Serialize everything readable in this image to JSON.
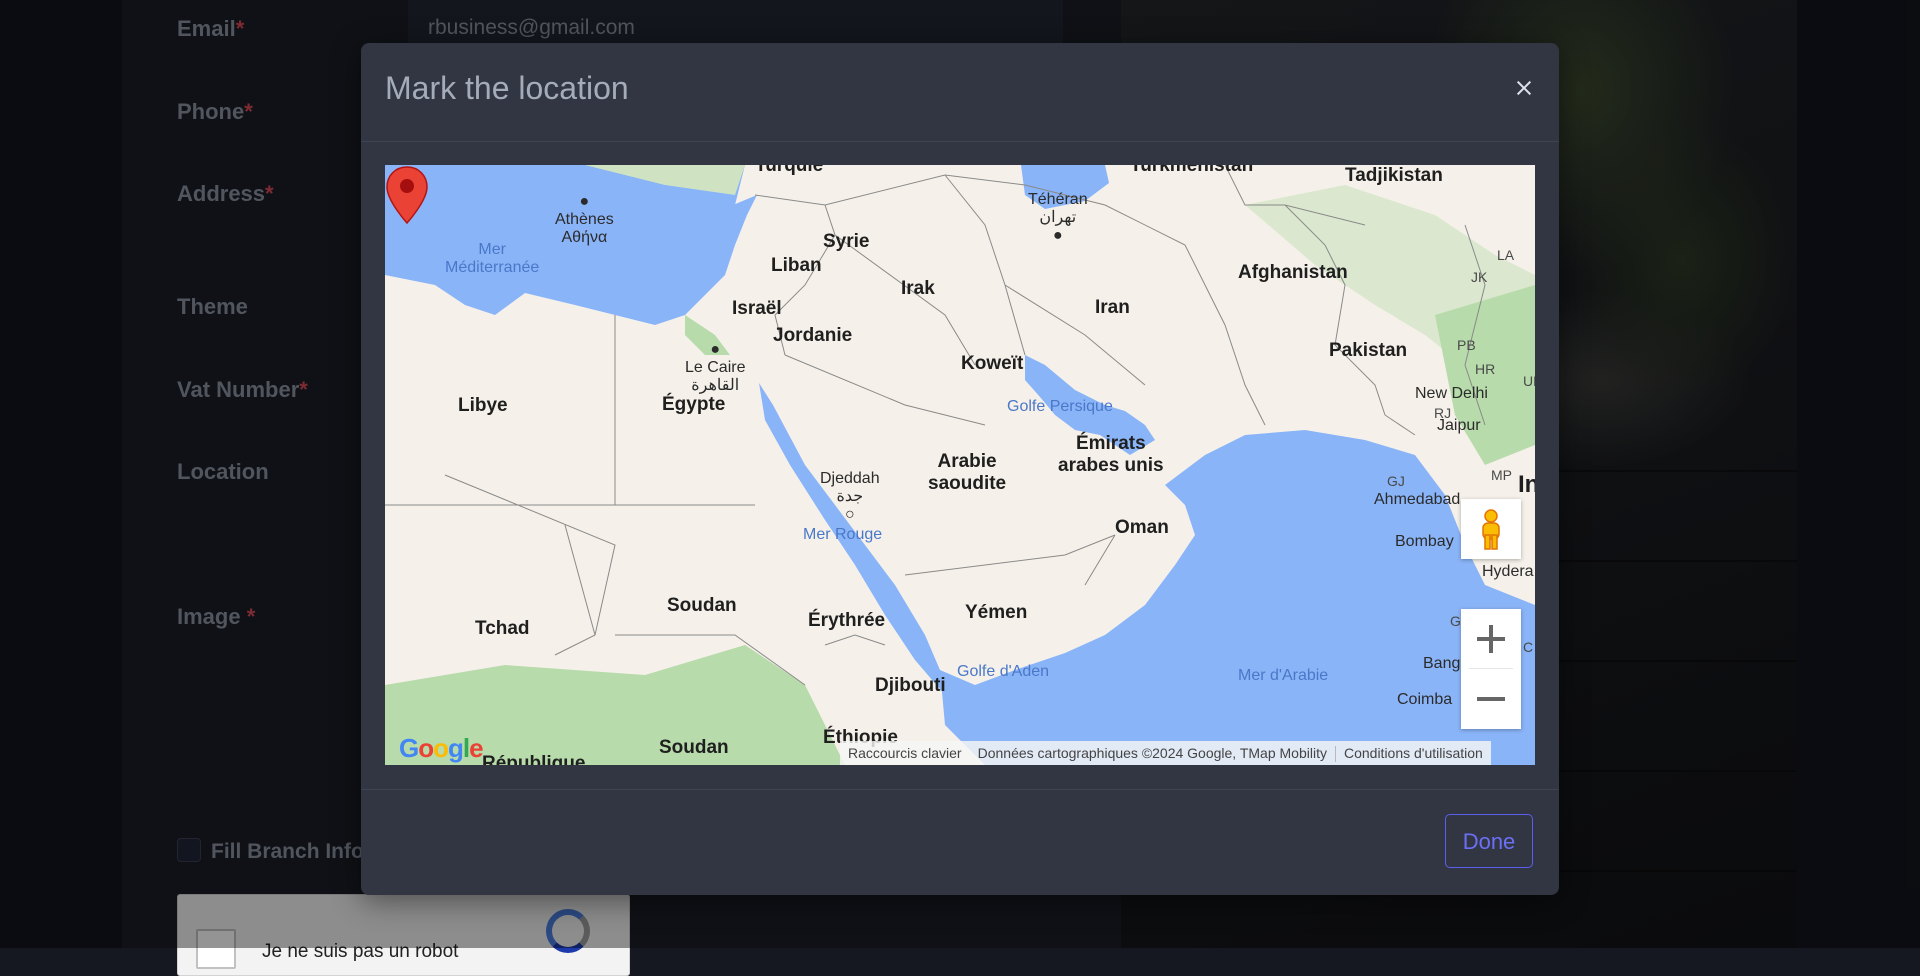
{
  "form": {
    "email_label": "Email",
    "email_value": "rbusiness@gmail.com",
    "phone_label": "Phone",
    "address_label": "Address",
    "theme_label": "Theme",
    "vat_label": "Vat Number",
    "location_label": "Location",
    "image_label": "Image ",
    "required_mark": "*",
    "fill_branch_label": "Fill Branch Info",
    "recaptcha_text": "Je ne suis pas un robot"
  },
  "modal": {
    "title": "Mark the location",
    "done_label": "Done"
  },
  "map": {
    "countries": {
      "turquie": "Turquie",
      "turkmenistan": "Turkménistan",
      "tadjikistan": "Tadjikistan",
      "syrie": "Syrie",
      "liban": "Liban",
      "israel": "Israël",
      "jordanie": "Jordanie",
      "irak": "Irak",
      "iran": "Iran",
      "afghanistan": "Afghanistan",
      "pakistan": "Pakistan",
      "koweit": "Koweït",
      "libye": "Libye",
      "egypte": "Égypte",
      "arabie_1": "Arabie",
      "arabie_2": "saoudite",
      "emirats_1": "Émirats",
      "emirats_2": "arabes unis",
      "oman": "Oman",
      "yemen": "Yémen",
      "soudan": "Soudan",
      "tchad": "Tchad",
      "erythree": "Érythrée",
      "djibouti": "Djibouti",
      "ethiopie": "Éthiopie",
      "soudan_sud": "Soudan",
      "republique": "République",
      "inde_partial": "In"
    },
    "cities": {
      "athenes_fr": "Athènes",
      "athenes_gr": "Αθήνα",
      "teheran_fr": "Téhéran",
      "teheran_fa": "تهران",
      "le_caire_fr": "Le Caire",
      "le_caire_ar": "القاهرة",
      "djeddah_fr": "Djeddah",
      "djeddah_ar": "جدة",
      "new_delhi": "New Delhi",
      "jaipur": "Jaipur",
      "ahmedabad": "Ahmedabad",
      "bombay": "Bombay",
      "hydera": "Hydera",
      "bang": "Bang",
      "coimba": "Coimba"
    },
    "water": {
      "mer_med_1": "Mer",
      "mer_med_2": "Méditerranée",
      "golfe_persique": "Golfe Persique",
      "mer_rouge": "Mer Rouge",
      "golfe_aden": "Golfe d'Aden",
      "mer_arabie": "Mer d'Arabie"
    },
    "small_labels": [
      "LA",
      "JK",
      "PB",
      "HR",
      "RJ",
      "GJ",
      "MP",
      "GA",
      "C",
      "UP"
    ],
    "attribution": {
      "shortcuts": "Raccourcis clavier",
      "data": "Données cartographiques ©2024 Google, TMap Mobility",
      "terms": "Conditions d'utilisation"
    },
    "logo": [
      "G",
      "o",
      "o",
      "g",
      "l",
      "e"
    ],
    "marker_color": "#ea4335",
    "land_color": "#f5f1ea",
    "water_color": "#8ab4f8",
    "green_color": "#b7dbaa"
  }
}
